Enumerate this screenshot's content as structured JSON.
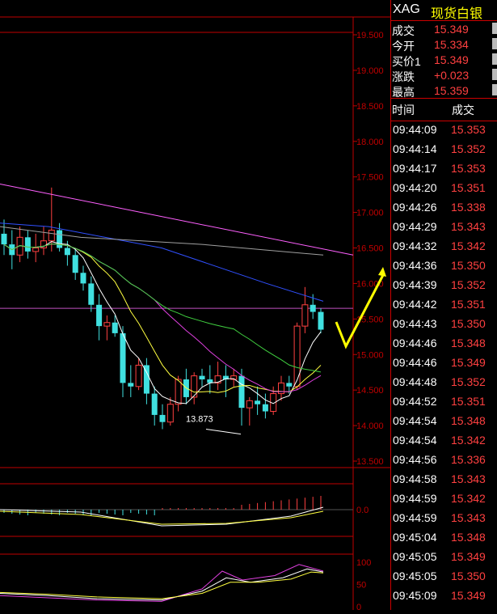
{
  "header": {
    "symbol": "XAG",
    "name": "现货白银"
  },
  "quote": [
    {
      "label": "成交",
      "value": "15.349"
    },
    {
      "label": "今开",
      "value": "15.334"
    },
    {
      "label": "买价1",
      "value": "15.349"
    },
    {
      "label": "涨跌",
      "value": "+0.023"
    },
    {
      "label": "最高",
      "value": "15.359"
    }
  ],
  "ticks_header": {
    "time": "时间",
    "price": "成交"
  },
  "ticks": [
    {
      "time": "09:44:09",
      "price": "15.353"
    },
    {
      "time": "09:44:14",
      "price": "15.352"
    },
    {
      "time": "09:44:17",
      "price": "15.353"
    },
    {
      "time": "09:44:20",
      "price": "15.351"
    },
    {
      "time": "09:44:26",
      "price": "15.338"
    },
    {
      "time": "09:44:29",
      "price": "15.343"
    },
    {
      "time": "09:44:32",
      "price": "15.342"
    },
    {
      "time": "09:44:36",
      "price": "15.350"
    },
    {
      "time": "09:44:39",
      "price": "15.352"
    },
    {
      "time": "09:44:42",
      "price": "15.351"
    },
    {
      "time": "09:44:43",
      "price": "15.350"
    },
    {
      "time": "09:44:46",
      "price": "15.348"
    },
    {
      "time": "09:44:46",
      "price": "15.349"
    },
    {
      "time": "09:44:48",
      "price": "15.352"
    },
    {
      "time": "09:44:52",
      "price": "15.351"
    },
    {
      "time": "09:44:54",
      "price": "15.348"
    },
    {
      "time": "09:44:54",
      "price": "15.342"
    },
    {
      "time": "09:44:56",
      "price": "15.336"
    },
    {
      "time": "09:44:58",
      "price": "15.343"
    },
    {
      "time": "09:44:59",
      "price": "15.342"
    },
    {
      "time": "09:44:59",
      "price": "15.343"
    },
    {
      "time": "09:45:04",
      "price": "15.348"
    },
    {
      "time": "09:45:05",
      "price": "15.349"
    },
    {
      "time": "09:45:05",
      "price": "15.350"
    },
    {
      "time": "09:45:09",
      "price": "15.349"
    }
  ],
  "price_axis": [
    "19.500",
    "19.000",
    "18.500",
    "18.000",
    "17.500",
    "17.000",
    "16.500",
    "16.000",
    "15.500",
    "15.000",
    "14.500",
    "14.000",
    "13.500"
  ],
  "macd_axis": "0.0",
  "kdj_axis": [
    "100",
    "50",
    "0"
  ],
  "annotation_low": "13.873",
  "colors": {
    "up": "#ff4040",
    "down": "#40e0e0",
    "grid": "#c00000",
    "axis_text": "#c00000",
    "arrow": "#ffff00"
  },
  "candles": [
    {
      "o": 16.7,
      "h": 16.9,
      "l": 16.4,
      "c": 16.55
    },
    {
      "o": 16.55,
      "h": 16.75,
      "l": 16.2,
      "c": 16.4
    },
    {
      "o": 16.4,
      "h": 16.8,
      "l": 16.3,
      "c": 16.65
    },
    {
      "o": 16.65,
      "h": 16.75,
      "l": 16.35,
      "c": 16.45
    },
    {
      "o": 16.45,
      "h": 16.7,
      "l": 16.3,
      "c": 16.5
    },
    {
      "o": 16.5,
      "h": 16.8,
      "l": 16.4,
      "c": 16.6
    },
    {
      "o": 16.6,
      "h": 17.35,
      "l": 16.45,
      "c": 16.75
    },
    {
      "o": 16.75,
      "h": 16.85,
      "l": 16.45,
      "c": 16.5
    },
    {
      "o": 16.5,
      "h": 16.6,
      "l": 16.25,
      "c": 16.4
    },
    {
      "o": 16.4,
      "h": 16.5,
      "l": 16.05,
      "c": 16.15
    },
    {
      "o": 16.15,
      "h": 16.25,
      "l": 15.9,
      "c": 16.0
    },
    {
      "o": 16.0,
      "h": 16.1,
      "l": 15.6,
      "c": 15.7
    },
    {
      "o": 15.7,
      "h": 15.85,
      "l": 15.2,
      "c": 15.4
    },
    {
      "o": 15.4,
      "h": 15.55,
      "l": 15.2,
      "c": 15.45
    },
    {
      "o": 15.45,
      "h": 15.55,
      "l": 15.25,
      "c": 15.3
    },
    {
      "o": 15.3,
      "h": 15.4,
      "l": 14.4,
      "c": 14.6
    },
    {
      "o": 14.6,
      "h": 14.85,
      "l": 14.4,
      "c": 14.55
    },
    {
      "o": 14.55,
      "h": 14.95,
      "l": 14.5,
      "c": 14.85
    },
    {
      "o": 14.85,
      "h": 14.95,
      "l": 14.3,
      "c": 14.45
    },
    {
      "o": 14.45,
      "h": 14.55,
      "l": 14.0,
      "c": 14.15
    },
    {
      "o": 14.15,
      "h": 14.3,
      "l": 13.95,
      "c": 14.05
    },
    {
      "o": 14.05,
      "h": 14.4,
      "l": 14.0,
      "c": 14.3
    },
    {
      "o": 14.3,
      "h": 14.7,
      "l": 14.2,
      "c": 14.65
    },
    {
      "o": 14.65,
      "h": 14.8,
      "l": 14.3,
      "c": 14.4
    },
    {
      "o": 14.4,
      "h": 14.75,
      "l": 14.3,
      "c": 14.7
    },
    {
      "o": 14.7,
      "h": 14.8,
      "l": 14.55,
      "c": 14.65
    },
    {
      "o": 14.65,
      "h": 14.85,
      "l": 14.45,
      "c": 14.6
    },
    {
      "o": 14.6,
      "h": 14.9,
      "l": 14.5,
      "c": 14.7
    },
    {
      "o": 14.7,
      "h": 14.85,
      "l": 14.4,
      "c": 14.65
    },
    {
      "o": 14.65,
      "h": 14.8,
      "l": 14.55,
      "c": 14.7
    },
    {
      "o": 14.7,
      "h": 14.8,
      "l": 14.0,
      "c": 14.25
    },
    {
      "o": 14.25,
      "h": 14.4,
      "l": 14.0,
      "c": 14.35
    },
    {
      "o": 14.35,
      "h": 14.55,
      "l": 14.15,
      "c": 14.3
    },
    {
      "o": 14.3,
      "h": 14.45,
      "l": 14.1,
      "c": 14.2
    },
    {
      "o": 14.2,
      "h": 14.55,
      "l": 14.15,
      "c": 14.45
    },
    {
      "o": 14.45,
      "h": 14.7,
      "l": 14.35,
      "c": 14.6
    },
    {
      "o": 14.6,
      "h": 14.7,
      "l": 14.45,
      "c": 14.55
    },
    {
      "o": 14.55,
      "h": 15.45,
      "l": 14.5,
      "c": 15.4
    },
    {
      "o": 15.4,
      "h": 15.95,
      "l": 15.3,
      "c": 15.7
    },
    {
      "o": 15.7,
      "h": 15.85,
      "l": 15.5,
      "c": 15.6
    },
    {
      "o": 15.6,
      "h": 15.65,
      "l": 15.3,
      "c": 15.35
    }
  ]
}
